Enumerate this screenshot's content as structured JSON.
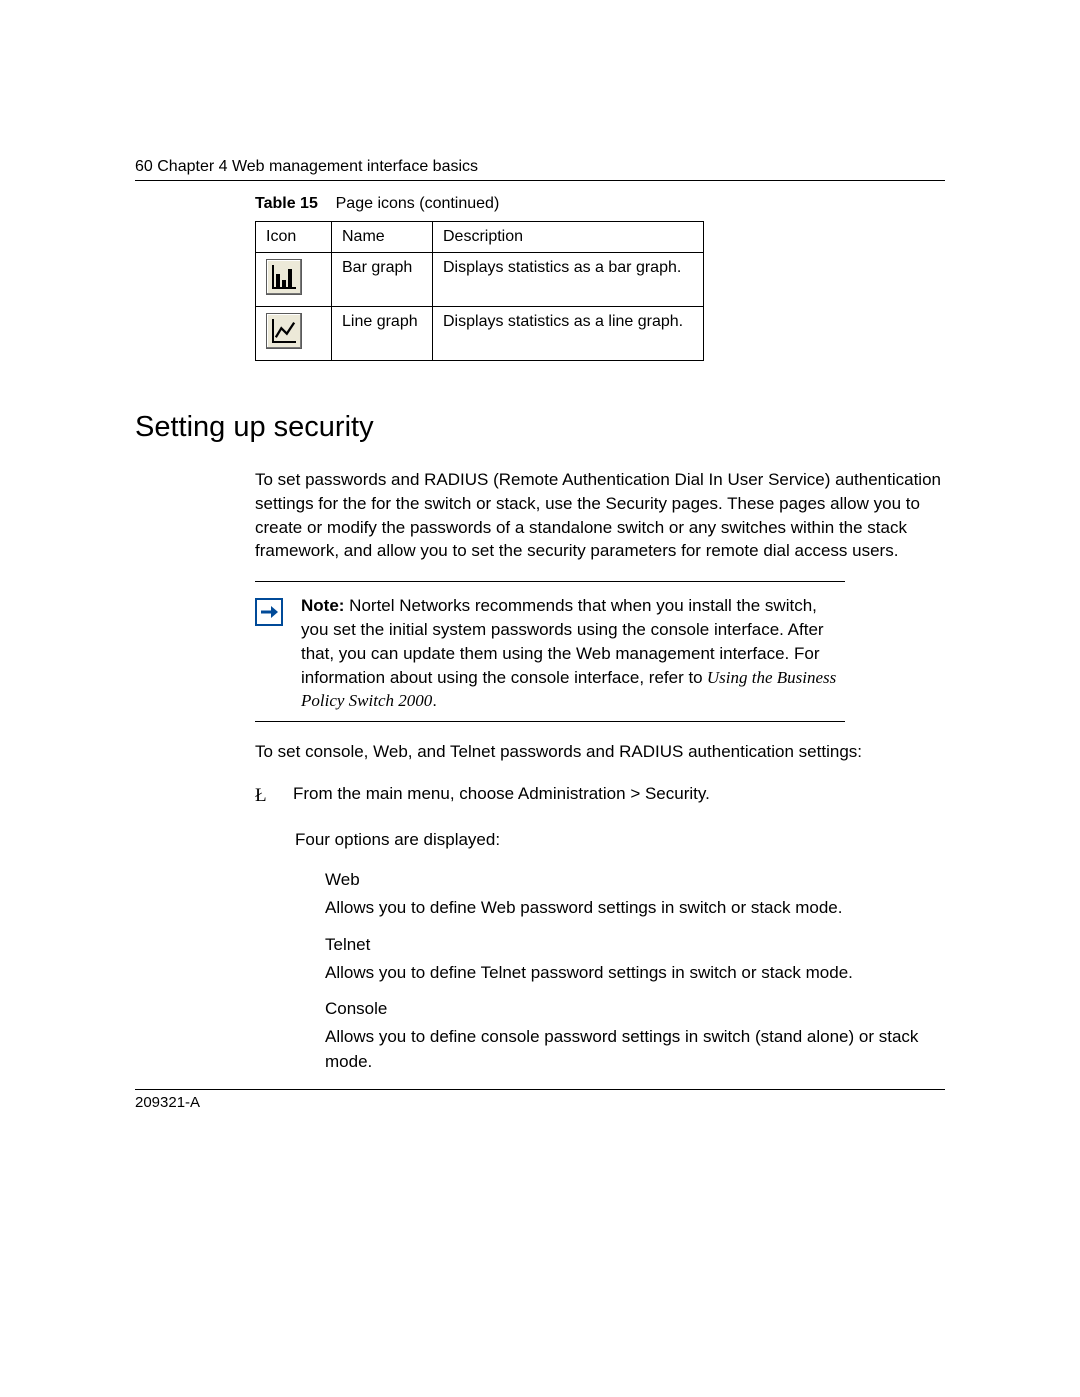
{
  "header": {
    "pageNumber": "60",
    "chapterLabel": "Chapter 4",
    "chapterTitle": "Web management interface basics"
  },
  "table": {
    "caption_prefix": "Table 15",
    "caption_text": "Page icons (continued)",
    "headers": {
      "c1": "Icon",
      "c2": "Name",
      "c3": "Description"
    },
    "rows": [
      {
        "name": "Bar graph",
        "desc": "Displays statistics as a bar graph."
      },
      {
        "name": "Line graph",
        "desc": "Displays statistics as a line graph."
      }
    ]
  },
  "section": {
    "heading": "Setting up security",
    "intro_a": "To set passwords and RADIUS (Remote Authentication Dial In User Service) authentication settings for the for the switch or stack, use the Security pages. These pages allow you to create o",
    "intro_b": "odify the passwords of a standalone switch or any switches within the stack framework, and allow you to set the security parameters for remote dial access users.",
    "intro_mid": "r m"
  },
  "note": {
    "label": "Note:",
    "text_a": " Nortel Networks recommends that when you install the switch, you set the initial system passwords using the console",
    "text_mid": " interf",
    "text_b": "ace. After that, you can update them using the Web management interface. For information about using the console in",
    "text_c": "terf",
    "text_d": "ace, refer to",
    "ref_a": " Using the Business Policy Switch 2000",
    "ref_b": "."
  },
  "after_note": "To set console, Web, and Telnet passwords and RADIUS authentication settings:",
  "step1": {
    "marker": "Ł",
    "text": "From the main menu, choose Administration > Security."
  },
  "options_intro": "Four options are displayed:",
  "options": [
    {
      "title": "Web",
      "desc": "Allows you to define Web password settings in switch or stack mode."
    },
    {
      "title": "Telnet",
      "desc": "Allows you to define Telnet password settings in switch or stack mode."
    },
    {
      "title": "Console",
      "desc": "Allows you to define console password settings in switch (stand alone) or stack mode."
    }
  ],
  "footer": "209321-A"
}
